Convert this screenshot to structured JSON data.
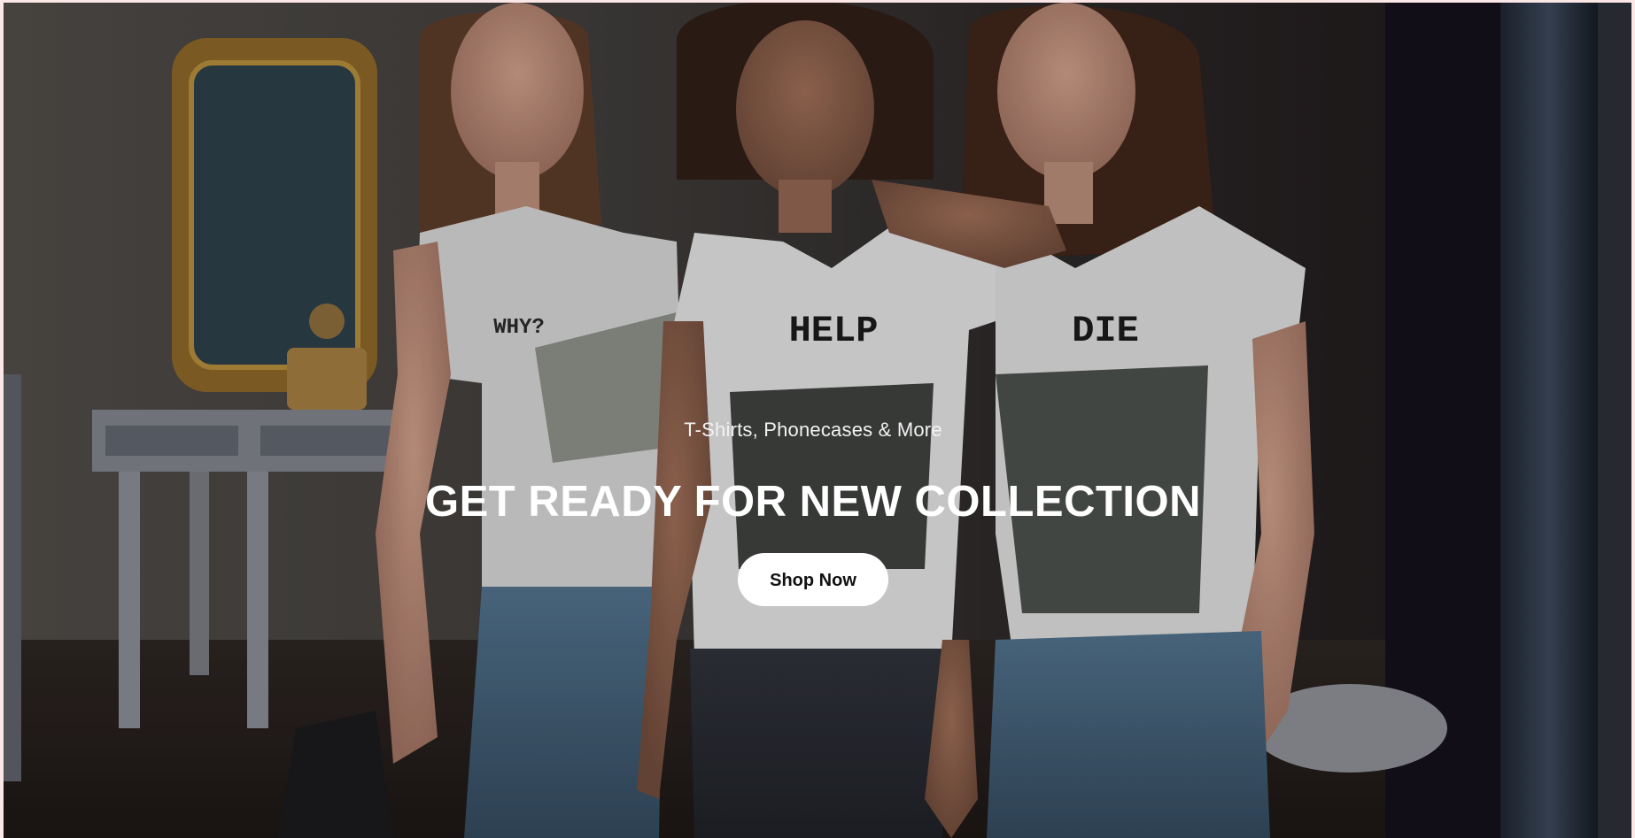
{
  "hero": {
    "subtitle": "T-Shirts, Phonecases & More",
    "headline": "GET READY FOR NEW COLLECTION",
    "cta_label": "Shop Now"
  },
  "shirts": {
    "left": "WHY?",
    "center": "HELP",
    "right": "DIE"
  },
  "colors": {
    "page_border": "#fbe7e6",
    "cta_background": "#ffffff",
    "cta_text": "#111111",
    "headline_text": "#ffffff"
  }
}
